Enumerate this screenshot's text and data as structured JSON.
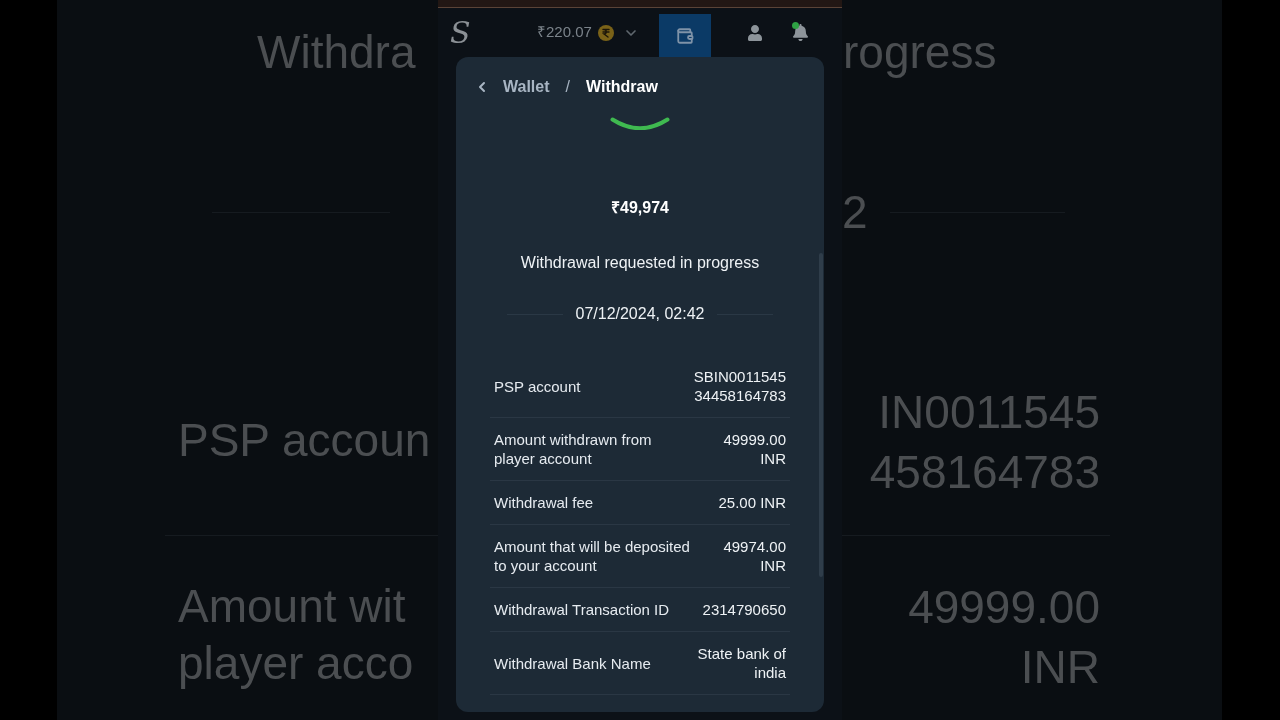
{
  "backdrop_left": {
    "heading": "Withdra",
    "rows": [
      "PSP accoun",
      "Amount wit\nplayer acco"
    ]
  },
  "backdrop_right": {
    "heading": "rogress",
    "date": "2",
    "rows": [
      "IN0011545\n458164783",
      "49999.00\nINR"
    ]
  },
  "top_bar": {
    "logo": "S",
    "balance": "₹220.07",
    "buttons": [
      {
        "kind": "wallet",
        "selected": true
      },
      {
        "kind": "profile",
        "selected": false
      },
      {
        "kind": "notifications",
        "selected": false,
        "alert": true
      }
    ]
  },
  "modal": {
    "breadcrumb": [
      {
        "label": "Wallet",
        "current": false
      },
      {
        "label": "Withdraw",
        "current": true
      }
    ],
    "separator": "/",
    "amount": "₹49,974",
    "status": "Withdrawal requested in progress",
    "date": "07/12/2024, 02:42",
    "details": [
      {
        "label": "PSP account",
        "value": "SBIN0011545\n34458164783"
      },
      {
        "label": "Amount withdrawn from\nplayer account",
        "value": "49999.00\nINR"
      },
      {
        "label": "Withdrawal fee",
        "value": "25.00 INR"
      },
      {
        "label": "Amount that will be deposited\nto your account",
        "value": "49974.00\nINR"
      },
      {
        "label": "Withdrawal Transaction ID",
        "value": "2314790650"
      },
      {
        "label": "Withdrawal Bank Name",
        "value": "State bank of\nindia"
      }
    ]
  }
}
